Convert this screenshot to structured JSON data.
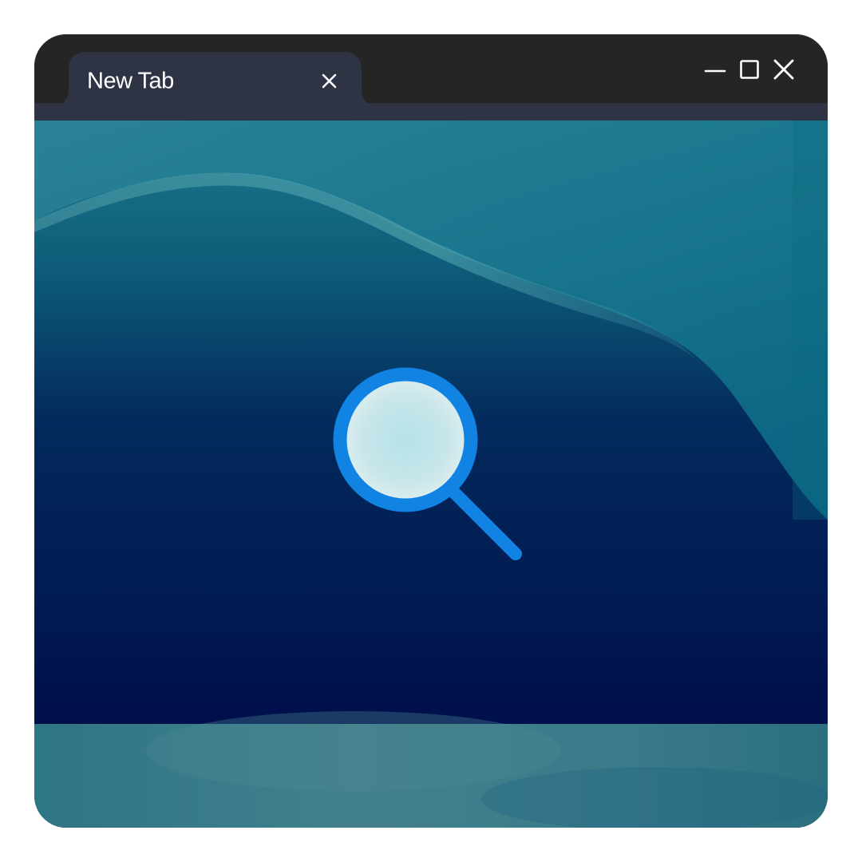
{
  "tabs": [
    {
      "title": "New Tab",
      "close_icon": "close-icon"
    }
  ],
  "window_controls": {
    "minimize_icon": "minimize-icon",
    "maximize_icon": "maximize-icon",
    "close_icon": "close-icon"
  },
  "content": {
    "center_icon": "search-icon"
  },
  "colors": {
    "titlebar": "#252525",
    "tab": "#2e3444",
    "accent": "#1183e3",
    "background_top": "#0f6f87",
    "background_bottom": "#000f4c",
    "footer_band": "#3d7d8a"
  }
}
